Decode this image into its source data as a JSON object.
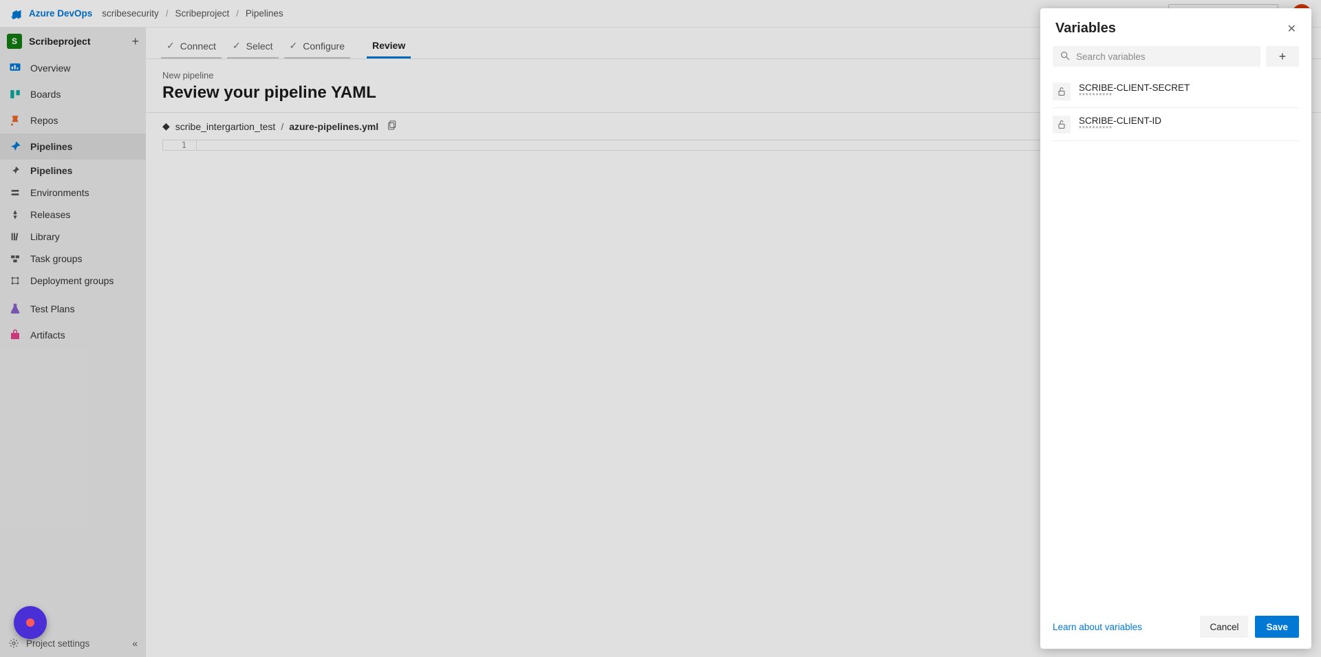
{
  "header": {
    "brand": "Azure DevOps",
    "crumbs": [
      "scribesecurity",
      "Scribeproject",
      "Pipelines"
    ]
  },
  "project": {
    "badge": "S",
    "name": "Scribeproject"
  },
  "sidebar": {
    "items": [
      {
        "label": "Overview"
      },
      {
        "label": "Boards"
      },
      {
        "label": "Repos"
      },
      {
        "label": "Pipelines"
      },
      {
        "label": "Test Plans"
      },
      {
        "label": "Artifacts"
      }
    ],
    "pipelines_sub": [
      "Pipelines",
      "Environments",
      "Releases",
      "Library",
      "Task groups",
      "Deployment groups"
    ],
    "settings_label": "Project settings"
  },
  "wizard": {
    "steps": [
      "Connect",
      "Select",
      "Configure",
      "Review"
    ],
    "pre_title": "New pipeline",
    "title": "Review your pipeline YAML"
  },
  "file": {
    "repo": "scribe_intergartion_test",
    "name": "azure-pipelines.yml",
    "line": "1"
  },
  "panel": {
    "title": "Variables",
    "search_placeholder": "Search variables",
    "variables": [
      {
        "name": "SCRIBE-CLIENT-SECRET",
        "mask": "**********"
      },
      {
        "name": "SCRIBE-CLIENT-ID",
        "mask": "**********"
      }
    ],
    "learn": "Learn about variables",
    "cancel": "Cancel",
    "save": "Save"
  }
}
